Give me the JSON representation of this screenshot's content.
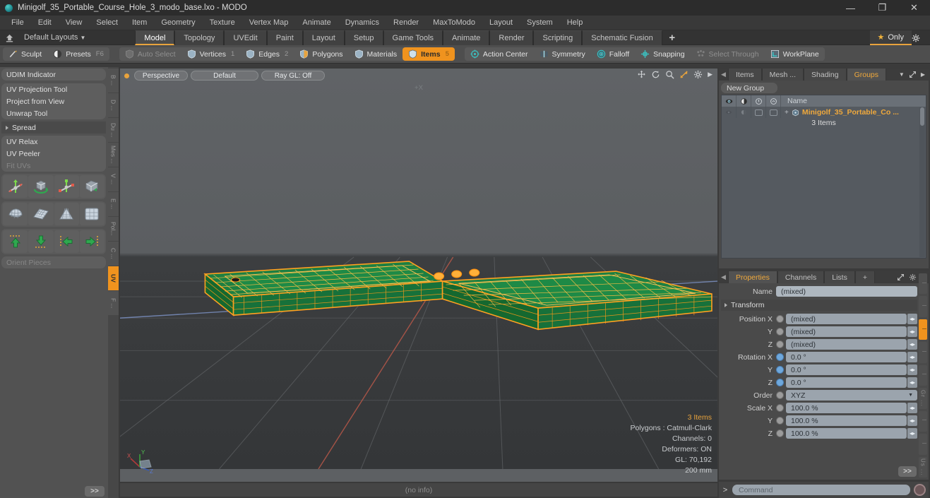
{
  "window": {
    "title": "Minigolf_35_Portable_Course_Hole_3_modo_base.lxo - MODO",
    "minimize": "—",
    "maximize": "❐",
    "close": "✕"
  },
  "menubar": {
    "items": [
      "File",
      "Edit",
      "View",
      "Select",
      "Item",
      "Geometry",
      "Texture",
      "Vertex Map",
      "Animate",
      "Dynamics",
      "Render",
      "MaxToModo",
      "Layout",
      "System",
      "Help"
    ]
  },
  "layoutbar": {
    "default_layouts": "Default Layouts",
    "tabs": [
      "Model",
      "Topology",
      "UVEdit",
      "Paint",
      "Layout",
      "Setup",
      "Game Tools",
      "Animate",
      "Render",
      "Scripting",
      "Schematic Fusion"
    ],
    "active_tab": "Model",
    "plus": "+",
    "only_label": "Only",
    "star": "★"
  },
  "toolbar": {
    "groups": [
      {
        "buttons": [
          {
            "label": "Sculpt",
            "icon": "sculpt-icon",
            "state": "normal"
          },
          {
            "label": "Presets",
            "icon": "presets-icon",
            "state": "normal",
            "shortcut": "F6"
          }
        ]
      },
      {
        "buttons": [
          {
            "label": "Auto Select",
            "icon": "auto-select-icon",
            "state": "dim"
          },
          {
            "label": "Vertices",
            "icon": "vertices-icon",
            "state": "normal",
            "count": "1"
          },
          {
            "label": "Edges",
            "icon": "edges-icon",
            "state": "normal",
            "count": "2"
          },
          {
            "label": "Polygons",
            "icon": "polygons-icon",
            "state": "normal"
          },
          {
            "label": "Materials",
            "icon": "materials-icon",
            "state": "normal"
          },
          {
            "label": "Items",
            "icon": "items-icon",
            "state": "active",
            "count": "5"
          }
        ]
      },
      {
        "buttons": [
          {
            "label": "Action Center",
            "icon": "action-center-icon",
            "state": "normal"
          },
          {
            "label": "Symmetry",
            "icon": "symmetry-icon",
            "state": "normal"
          },
          {
            "label": "Falloff",
            "icon": "falloff-icon",
            "state": "normal"
          },
          {
            "label": "Snapping",
            "icon": "snapping-icon",
            "state": "normal"
          },
          {
            "label": "Select Through",
            "icon": "select-through-icon",
            "state": "dim"
          },
          {
            "label": "WorkPlane",
            "icon": "workplane-icon",
            "state": "normal"
          }
        ]
      }
    ]
  },
  "left_panel": {
    "rows_top": [
      "UDIM Indicator"
    ],
    "group_uv": [
      "UV Projection Tool",
      "Project from View",
      "Unwrap Tool"
    ],
    "spread_header": "Spread",
    "group_relax": [
      "UV Relax",
      "UV Peeler"
    ],
    "fit_uvs": "Fit UVs",
    "orient_pieces": "Orient Pieces",
    "more_button": ">>",
    "vtabs": [
      {
        "label": "B ...",
        "active": false
      },
      {
        "label": "D ...",
        "active": false
      },
      {
        "label": "Du ...",
        "active": false
      },
      {
        "label": "Mes ...",
        "active": false
      },
      {
        "label": "V ...",
        "active": false
      },
      {
        "label": "E ...",
        "active": false
      },
      {
        "label": "Pol...",
        "active": false
      },
      {
        "label": "C ...",
        "active": false
      },
      {
        "label": "UV",
        "active": true
      },
      {
        "label": "F ...",
        "active": false
      }
    ]
  },
  "viewport": {
    "view_mode": "Perspective",
    "shading_mode": "Default",
    "raygl": "Ray GL: Off",
    "axis_label": "+X",
    "info": {
      "items": "3 Items",
      "polygons": "Polygons : Catmull-Clark",
      "channels": "Channels: 0",
      "deformers": "Deformers: ON",
      "gl": "GL: 70,192",
      "scale": "200 mm"
    },
    "header_icons": [
      "move-icon",
      "rotate-icon",
      "zoom-icon",
      "fit-icon",
      "gear-icon",
      "chevron-right-icon"
    ]
  },
  "statusbar": {
    "text": "(no info)"
  },
  "right_panel": {
    "top_tabs": [
      "Items",
      "Mesh ...",
      "Shading",
      "Groups"
    ],
    "top_active_tab": "Groups",
    "new_group_label": "New Group",
    "tree": {
      "name_header": "Name",
      "item_label": "Minigolf_35_Portable_Co  ...",
      "item_sub": "3 Items"
    },
    "bottom_tabs": [
      "Properties",
      "Channels",
      "Lists"
    ],
    "bottom_active_tab": "Properties",
    "bottom_plus": "+",
    "name_label": "Name",
    "name_value": "(mixed)",
    "transform_label": "Transform",
    "fields": [
      {
        "label": "Position X",
        "value": "(mixed)",
        "radio": "gray"
      },
      {
        "label": "Y",
        "value": "(mixed)",
        "radio": "gray"
      },
      {
        "label": "Z",
        "value": "(mixed)",
        "radio": "gray"
      },
      {
        "label": "Rotation X",
        "value": "0.0 °",
        "radio": "blue"
      },
      {
        "label": "Y",
        "value": "0.0 °",
        "radio": "blue"
      },
      {
        "label": "Z",
        "value": "0.0 °",
        "radio": "blue"
      }
    ],
    "order_label": "Order",
    "order_value": "XYZ",
    "scale_fields": [
      {
        "label": "Scale X",
        "value": "100.0 %",
        "radio": "gray"
      },
      {
        "label": "Y",
        "value": "100.0 %",
        "radio": "gray"
      },
      {
        "label": "Z",
        "value": "100.0 %",
        "radio": "gray"
      }
    ],
    "more_button": ">>",
    "side_tabs": [
      "Gr ...",
      "Us ..."
    ]
  },
  "command_bar": {
    "caret": ">",
    "placeholder": "Command",
    "record_icon": "record-icon"
  },
  "colors": {
    "accent": "#f0931e",
    "accent_text": "#f0a93c",
    "wire": "#ffa020",
    "green": "#1d8a45",
    "panel": "#4a4a4a",
    "viewport_bg": "#5d6063"
  }
}
